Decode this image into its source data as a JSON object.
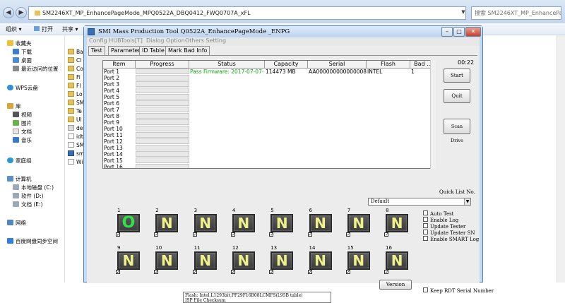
{
  "explorer": {
    "address": "SM2246XT_MP_EnhancePageMode_MPQ0522A_DBQ0412_FWQ0707A_xFL",
    "search_placeholder": "搜索 SM2246XT_MP_EnhancePage...",
    "toolbar": {
      "organize": "组织 ▾",
      "open": "打开",
      "share": "共享 ▾"
    },
    "sidebar": [
      "收藏夹",
      "下载",
      "桌面",
      "最近访问的位置",
      "WPS云盘",
      "库",
      "视频",
      "图片",
      "文档",
      "音乐",
      "家庭组",
      "计算机",
      "本地磁盘 (C:)",
      "软件 (D:)",
      "文档 (E:)",
      "网络",
      "百度网盘同步空间"
    ],
    "files": [
      "Ba",
      "Cl",
      "Co",
      "Fi",
      "Fl",
      "Lo",
      "SM",
      "Te",
      "Ul",
      "de",
      "idt",
      "SM",
      "sm",
      "Wi"
    ]
  },
  "smi": {
    "title": "SMI Mass Production Tool Q0522A_EnhancePageMode     _ENPG",
    "menu": [
      "Config HUB",
      "Tools[T]",
      "Dialog Option",
      "Others Setting"
    ],
    "tabs": [
      "Test",
      "Parameter",
      "ID Table",
      "Mark Bad Info"
    ],
    "table": {
      "headers": [
        "Item",
        "Progress",
        "Status",
        "Capacity",
        "Serial",
        "Flash",
        "Bad ..."
      ],
      "rows": [
        {
          "port": "Port 1",
          "status": "Pass   Firmware: 2017-07-07-AE",
          "capacity": "114473 MB",
          "serial": "AA00000000000000825",
          "flash": "INTEL",
          "bad": "1"
        },
        {
          "port": "Port 2"
        },
        {
          "port": "Port 3"
        },
        {
          "port": "Port 4"
        },
        {
          "port": "Port 5"
        },
        {
          "port": "Port 6"
        },
        {
          "port": "Port 7"
        },
        {
          "port": "Port 8"
        },
        {
          "port": "Port 9"
        },
        {
          "port": "Port 10"
        },
        {
          "port": "Port 11"
        },
        {
          "port": "Port 12"
        },
        {
          "port": "Port 13"
        },
        {
          "port": "Port 14"
        },
        {
          "port": "Port 15"
        },
        {
          "port": "Port 16"
        }
      ]
    },
    "timer": "00:22",
    "buttons": {
      "start": "Start",
      "quit": "Quit",
      "scan": "Scan Drive",
      "version": "Version"
    },
    "quicklist_label": "Quick List No.",
    "quicklist_value": "Default",
    "options": [
      "Auto Test",
      "Enable Log",
      "Update Tester",
      "Update Tester SN",
      "Enable SMART Log"
    ],
    "keep_rdt": "Keep RDT Serial Number",
    "ports": [
      {
        "num": "1",
        "state": "O",
        "ok": true
      },
      {
        "num": "2",
        "state": "N"
      },
      {
        "num": "3",
        "state": "N"
      },
      {
        "num": "4",
        "state": "N"
      },
      {
        "num": "5",
        "state": "N"
      },
      {
        "num": "6",
        "state": "N"
      },
      {
        "num": "7",
        "state": "N"
      },
      {
        "num": "8",
        "state": "N"
      },
      {
        "num": "9",
        "state": "N"
      },
      {
        "num": "10",
        "state": "N"
      },
      {
        "num": "11",
        "state": "N"
      },
      {
        "num": "12",
        "state": "N"
      },
      {
        "num": "13",
        "state": "N"
      },
      {
        "num": "14",
        "state": "N"
      },
      {
        "num": "15",
        "state": "N"
      },
      {
        "num": "16",
        "state": "N"
      }
    ],
    "log_lines": [
      "Flash: Intel,L1293bit,PF29F16B08LCMFS(L95B table)",
      "ISP File Checksum"
    ]
  },
  "colors": {
    "status_pass": "#13a313",
    "led_text": "#eef08a",
    "led_ok": "#32e04a"
  }
}
